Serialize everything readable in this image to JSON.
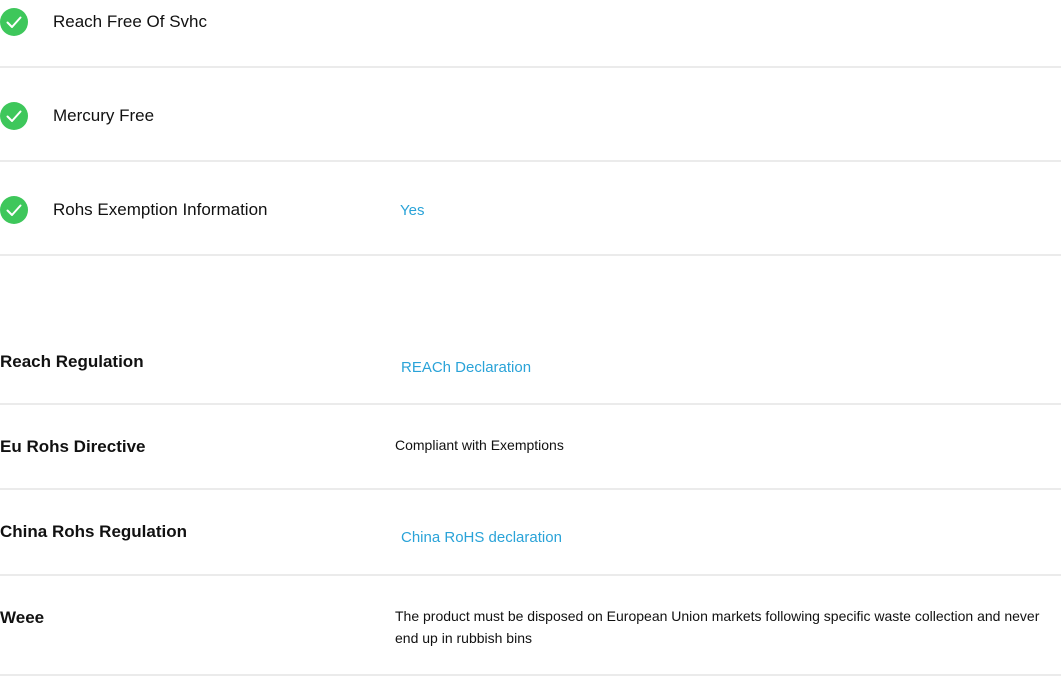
{
  "checks": [
    {
      "label": "Reach Free Of Svhc",
      "value": "",
      "icon": "checkmark-circle-icon"
    },
    {
      "label": "Mercury Free",
      "value": "",
      "icon": "checkmark-circle-icon"
    },
    {
      "label": "Rohs Exemption Information",
      "value": "Yes",
      "icon": "checkmark-circle-icon"
    }
  ],
  "regulations": [
    {
      "label": "Reach Regulation",
      "value": "REACh Declaration",
      "kind": "link"
    },
    {
      "label": "Eu Rohs Directive",
      "value": "Compliant with Exemptions",
      "kind": "text"
    },
    {
      "label": "China Rohs Regulation",
      "value": "China RoHS declaration",
      "kind": "link"
    },
    {
      "label": "Weee",
      "value": "The product must be disposed on European Union markets following specific waste collection and never end up in rubbish bins",
      "kind": "text"
    }
  ],
  "colors": {
    "check_green": "#3ec75b",
    "link_blue": "#2aa3d8",
    "divider": "#ebebeb"
  }
}
